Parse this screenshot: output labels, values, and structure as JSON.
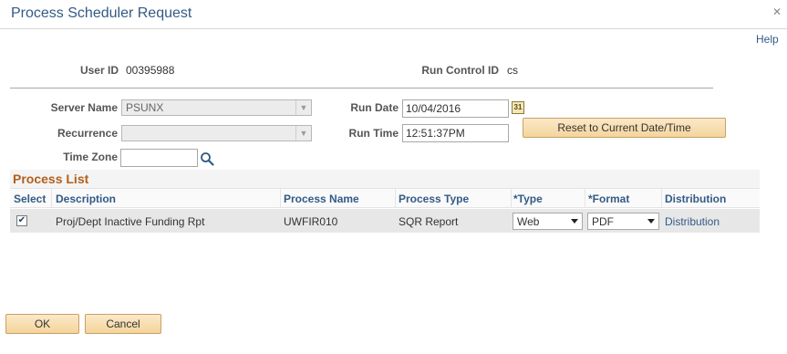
{
  "header": {
    "title": "Process Scheduler Request",
    "help_link": "Help"
  },
  "user": {
    "user_id_label": "User ID",
    "user_id": "00395988",
    "run_control_label": "Run Control ID",
    "run_control": "cs"
  },
  "form": {
    "server_name_label": "Server Name",
    "server_name": "PSUNX",
    "recurrence_label": "Recurrence",
    "recurrence": "",
    "time_zone_label": "Time Zone",
    "time_zone": "",
    "run_date_label": "Run Date",
    "run_date": "10/04/2016",
    "run_time_label": "Run Time",
    "run_time": "12:51:37PM",
    "reset_button": "Reset to Current Date/Time"
  },
  "process_list": {
    "title": "Process List",
    "columns": [
      "Select",
      "Description",
      "Process Name",
      "Process Type",
      "*Type",
      "*Format",
      "Distribution"
    ],
    "rows": [
      {
        "selected": true,
        "description": "Proj/Dept Inactive Funding Rpt",
        "process_name": "UWFIR010",
        "process_type": "SQR Report",
        "type": "Web",
        "format": "PDF",
        "distribution": "Distribution"
      }
    ]
  },
  "footer": {
    "ok": "OK",
    "cancel": "Cancel"
  },
  "icons": {
    "close": "close-icon",
    "calendar": "calendar-icon",
    "search": "search-icon"
  },
  "colors": {
    "title": "#335a86",
    "section_title": "#b35f1a",
    "button_bg": "#f4d49b",
    "button_border": "#c9a063"
  }
}
